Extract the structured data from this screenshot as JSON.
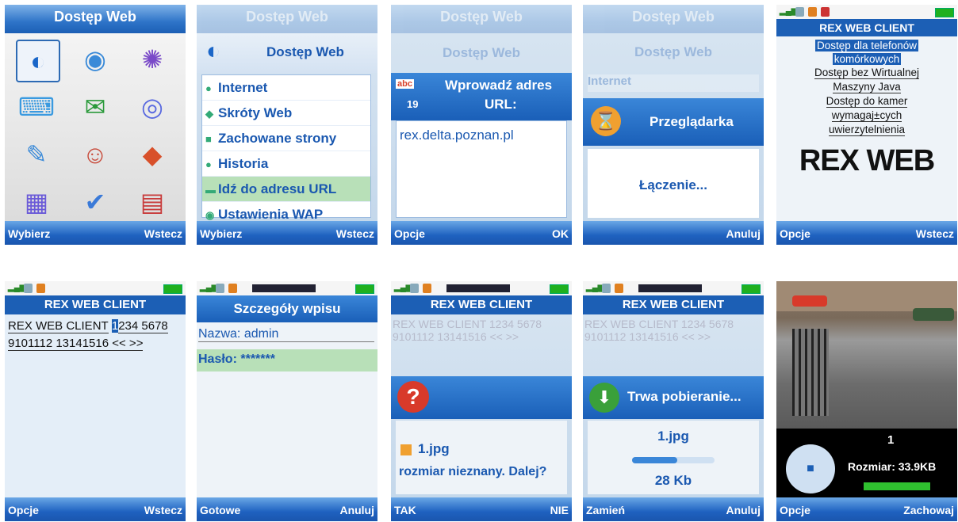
{
  "screens": {
    "s1": {
      "title": "Dostęp Web",
      "left": "Wybierz",
      "right": "Wstecz"
    },
    "s2": {
      "faded_title": "Dostęp Web",
      "header": "Dostęp Web",
      "items": [
        "Internet",
        "Skróty Web",
        "Zachowane strony",
        "Historia",
        "Idź do adresu URL",
        "Ustawienia WAP"
      ],
      "left": "Wybierz",
      "right": "Wstecz"
    },
    "s3": {
      "faded_title": "Dostęp Web",
      "faded_header": "Dostęp Web",
      "mode": "abc",
      "count": "19",
      "prompt1": "Wprowadź adres",
      "prompt2": "URL:",
      "url": "rex.delta.poznan.pl",
      "left": "Opcje",
      "right": "OK"
    },
    "s4": {
      "faded_title": "Dostęp Web",
      "faded_header": "Dostęp Web",
      "faded_item": "Internet",
      "header": "Przeglądarka",
      "message": "Łączenie...",
      "right": "Anuluj"
    },
    "s5": {
      "header": "REX WEB CLIENT",
      "links": [
        "Dostęp dla telefonów",
        "komórkowych",
        "Dostęp bez Wirtualnej",
        "Maszyny Java",
        "Dostęp do kamer",
        "wymagaj±cych",
        "uwierzytelnienia"
      ],
      "logo": "REX WEB",
      "left": "Opcje",
      "right": "Wstecz"
    },
    "s6": {
      "header": "REX WEB CLIENT",
      "line1": "REX WEB CLIENT",
      "line1b": "1",
      "line1c": "234 5678",
      "line2": "9101112 13141516 << >>",
      "left": "Opcje",
      "right": "Wstecz"
    },
    "s7": {
      "header": "Szczegóły wpisu",
      "name_label": "Nazwa:",
      "name_value": "admin",
      "pass_label": "Hasło:",
      "pass_value": "*******",
      "left": "Gotowe",
      "right": "Anuluj"
    },
    "s8": {
      "header": "REX WEB CLIENT",
      "faded1": "REX WEB CLIENT 1234 5678",
      "faded2": "9101112 13141516 << >>",
      "file": "1.jpg",
      "question": "rozmiar nieznany. Dalej?",
      "left": "TAK",
      "right": "NIE"
    },
    "s9": {
      "header": "REX WEB CLIENT",
      "faded1": "REX WEB CLIENT 1234 5678",
      "faded2": "9101112 13141516 << >>",
      "status": "Trwa pobieranie...",
      "file": "1.jpg",
      "size": "28 Kb",
      "progress": 0.55,
      "left": "Zamień",
      "right": "Anuluj"
    },
    "s10": {
      "index": "1",
      "size": "Rozmiar: 33.9KB",
      "progress": 1.0,
      "left": "Opcje",
      "right": "Zachowaj"
    }
  },
  "colors": {
    "accent": "#1c5fb5",
    "highlight": "#b8e0b8",
    "link_bg": "#1c5fb5"
  }
}
